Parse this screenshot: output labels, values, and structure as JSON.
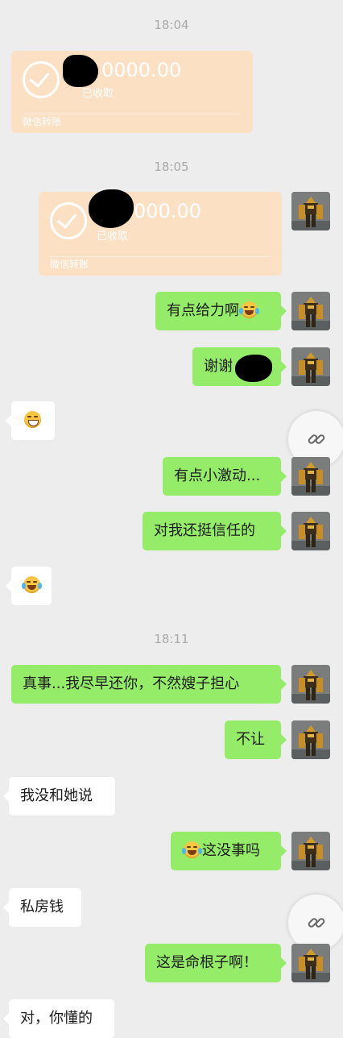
{
  "timestamps": [
    "18:04",
    "18:05",
    "18:11"
  ],
  "transfers": [
    {
      "amount": "0000.00",
      "status": "已收取",
      "footer": "微信转账"
    },
    {
      "amount": "000.00",
      "status": "已收取",
      "footer": "微信转账"
    }
  ],
  "messages": {
    "m1": "有点给力啊",
    "m2": "谢谢",
    "m3": "有点小激动...",
    "m4": "对我还挺信任的",
    "m5": "真事...我尽早还你，不然嫂子担心",
    "m6": "不让",
    "m7": "我没和她说",
    "m8": "这没事吗",
    "m9": "私房钱",
    "m10": "这是命根子啊！",
    "m11": "对，你懂的"
  },
  "icons": {
    "link": "link-icon",
    "emoji_grin": "grin-emoji",
    "emoji_laugh_cry": "laugh-cry-emoji",
    "avatar": "robot-avatar"
  },
  "colors": {
    "background": "#ededed",
    "my_bubble": "#95ec69",
    "their_bubble": "#ffffff",
    "transfer": "#fce0c4"
  }
}
